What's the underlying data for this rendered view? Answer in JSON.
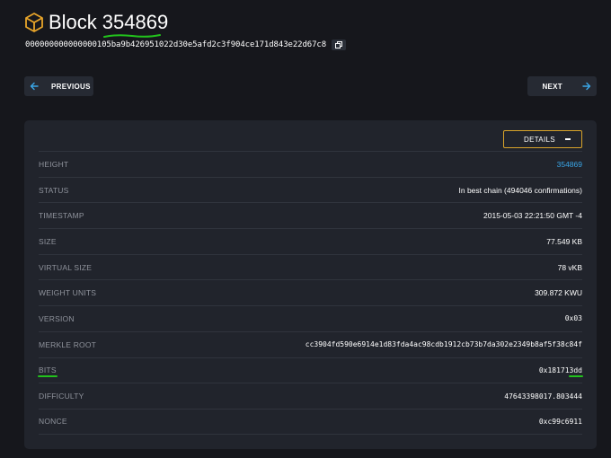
{
  "header": {
    "title_prefix": "Block",
    "block_number": "354869",
    "hash": "000000000000000105ba9b426951022d30e5afd2c3f904ce171d843e22d67c8"
  },
  "nav": {
    "previous_label": "PREVIOUS",
    "next_label": "NEXT"
  },
  "details": {
    "toggle_label": "DETAILS",
    "rows": [
      {
        "key": "HEIGHT",
        "value": "354869"
      },
      {
        "key": "STATUS",
        "value": "In best chain (494046 confirmations)"
      },
      {
        "key": "TIMESTAMP",
        "value": "2015-05-03 22:21:50 GMT -4"
      },
      {
        "key": "SIZE",
        "value": "77.549 KB"
      },
      {
        "key": "VIRTUAL SIZE",
        "value": "78 vKB"
      },
      {
        "key": "WEIGHT UNITS",
        "value": "309.872 KWU"
      },
      {
        "key": "VERSION",
        "value": "0x03"
      },
      {
        "key": "MERKLE ROOT",
        "value": "cc3904fd590e6914e1d83fda4ac98cdb1912cb73b7da302e2349b8af5f38c84f"
      },
      {
        "key": "BITS",
        "value": "0x181713dd"
      },
      {
        "key": "DIFFICULTY",
        "value": "47643398017.803444"
      },
      {
        "key": "NONCE",
        "value": "0xc99c6911"
      }
    ]
  },
  "colors": {
    "accent_gold": "#d8a32a",
    "link_blue": "#3aa7e8",
    "annotation_green": "#22c21c"
  }
}
